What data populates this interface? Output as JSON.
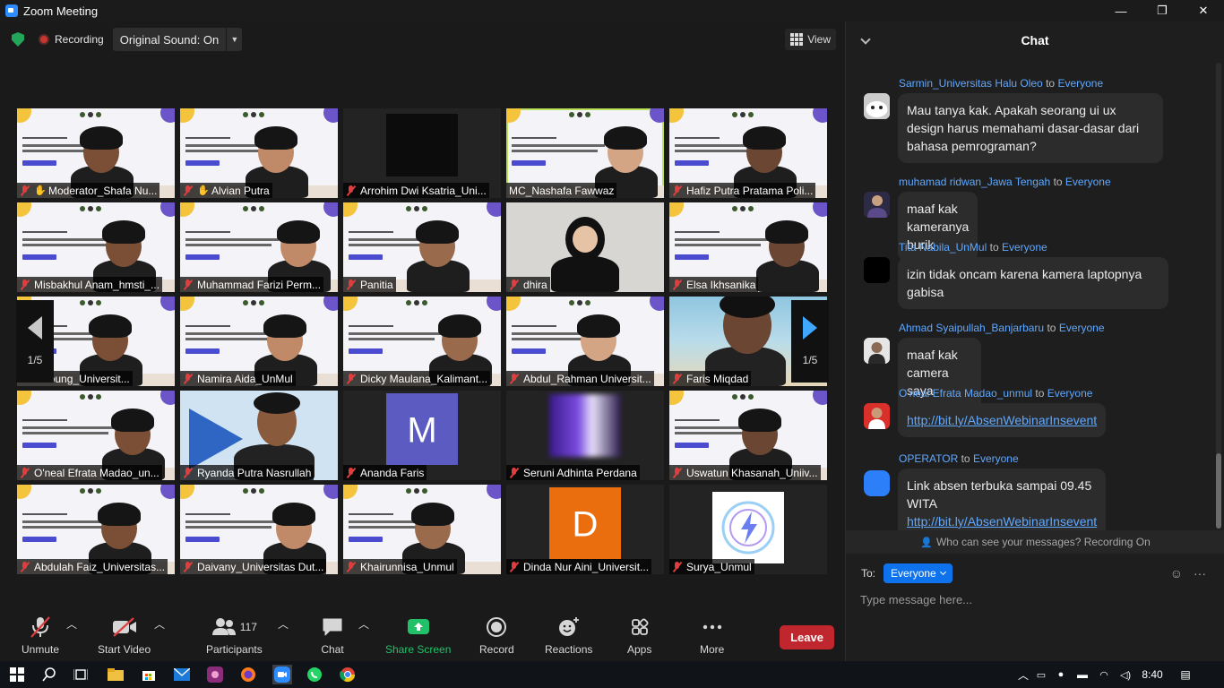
{
  "window": {
    "title": "Zoom Meeting",
    "controls": [
      "—",
      "❐",
      "✕"
    ]
  },
  "meeting_bar": {
    "recording_label": "Recording",
    "original_sound_label": "Original Sound: On",
    "view_label": "View"
  },
  "gallery": {
    "page_left": "1/5",
    "page_right": "1/5",
    "tiles": [
      {
        "name": "Moderator_Shafa Nu...",
        "icon": "hand",
        "bg": "webinar"
      },
      {
        "name": "Alvian Putra",
        "icon": "hand",
        "bg": "webinar"
      },
      {
        "name": "Arrohim Dwi Ksatria_Uni...",
        "icon": "mic-off",
        "bg": "dark"
      },
      {
        "name": "MC_Nashafa Fawwaz",
        "icon": "none",
        "bg": "webinar",
        "speaking": true
      },
      {
        "name": "Hafiz Putra Pratama Poli...",
        "icon": "mic-off",
        "bg": "webinar"
      },
      {
        "name": "Misbakhul Anam_hmsti_...",
        "icon": "mic-off",
        "bg": "webinar"
      },
      {
        "name": "Muhammad Farizi Perm...",
        "icon": "mic-off",
        "bg": "webinar"
      },
      {
        "name": "Panitia",
        "icon": "mic-off",
        "bg": "webinar"
      },
      {
        "name": "dhira",
        "icon": "mic-off",
        "bg": "room"
      },
      {
        "name": "Elsa Ikhsanika",
        "icon": "mic-off",
        "bg": "webinar"
      },
      {
        "name": "iana Young_Universit...",
        "icon": "none",
        "bg": "webinar"
      },
      {
        "name": "Namira Aida_UnMul",
        "icon": "mic-off",
        "bg": "webinar"
      },
      {
        "name": "Dicky Maulana_Kalimant...",
        "icon": "mic-off",
        "bg": "webinar"
      },
      {
        "name": "Abdul_Rahman Universit...",
        "icon": "mic-off",
        "bg": "webinar"
      },
      {
        "name": "Faris Miqdad",
        "icon": "mic-off",
        "bg": "beach"
      },
      {
        "name": "O'neal Efrata Madao_un...",
        "icon": "mic-off",
        "bg": "webinar"
      },
      {
        "name": "Ryanda Putra Nasrullah",
        "icon": "mic-off",
        "bg": "blue"
      },
      {
        "name": "Ananda Faris",
        "icon": "mic-off",
        "bg": "avatar",
        "letter": "M",
        "letter_color": "#5b5bc2"
      },
      {
        "name": "Seruni Adhinta Perdana",
        "icon": "mic-off",
        "bg": "blur"
      },
      {
        "name": "Uswatun Khasanah_Uniiv...",
        "icon": "mic-off",
        "bg": "webinar"
      },
      {
        "name": "Abdulah Faiz_Universitas...",
        "icon": "mic-off",
        "bg": "webinar"
      },
      {
        "name": "Daivany_Universitas Dut...",
        "icon": "mic-off",
        "bg": "webinar"
      },
      {
        "name": "Khairunnisa_Unmul",
        "icon": "mic-off",
        "bg": "webinar"
      },
      {
        "name": "Dinda Nur Aini_Universit...",
        "icon": "mic-off",
        "bg": "avatar",
        "letter": "D",
        "letter_color": "#ea6d0e"
      },
      {
        "name": "Surya_Unmul",
        "icon": "mic-off",
        "bg": "logo"
      }
    ]
  },
  "toolbar": {
    "unmute": "Unmute",
    "start_video": "Start Video",
    "participants": "Participants",
    "participant_count": "117",
    "chat": "Chat",
    "share_screen": "Share Screen",
    "record": "Record",
    "reactions": "Reactions",
    "apps": "Apps",
    "more": "More",
    "leave": "Leave"
  },
  "chat": {
    "title": "Chat",
    "messages": [
      {
        "from": "Sarmin_Universitas Halu Oleo",
        "to": "to",
        "recipient": "Everyone",
        "text": "Mau tanya kak. Apakah seorang ui ux design harus memahami dasar-dasar dari bahasa pemrograman?"
      },
      {
        "from": "muhamad ridwan_Jawa Tengah",
        "to": "to",
        "recipient": "Everyone",
        "text": "maaf kak kameranya burik"
      },
      {
        "from": "Tita Nabila_UnMul",
        "to": "to",
        "recipient": "Everyone",
        "text": "izin tidak oncam karena kamera laptopnya gabisa"
      },
      {
        "from": "Ahmad Syaipullah_Banjarbaru",
        "to": "to",
        "recipient": "Everyone",
        "text": "maaf kak camera saya bermasalah"
      },
      {
        "from": "O'neal Efrata Madao_unmul",
        "to": "to",
        "recipient": "Everyone",
        "link": "http://bit.ly/AbsenWebinarInsevent"
      },
      {
        "from": "OPERATOR",
        "to": "to",
        "recipient": "Everyone",
        "text": "Link absen terbuka sampai 09.45 WITA",
        "link": "http://bit.ly/AbsenWebinarInsevent"
      }
    ],
    "who_can_see": "Who can see your messages? Recording On",
    "to_label": "To:",
    "to_value": "Everyone",
    "input_placeholder": "Type message here..."
  },
  "taskbar": {
    "time": "8:40"
  },
  "colors": {
    "accent": "#0e72ed",
    "leave": "#c0262d",
    "link": "#5fa8ff",
    "share": "#23c06a",
    "mute_red": "#e03e3e"
  }
}
